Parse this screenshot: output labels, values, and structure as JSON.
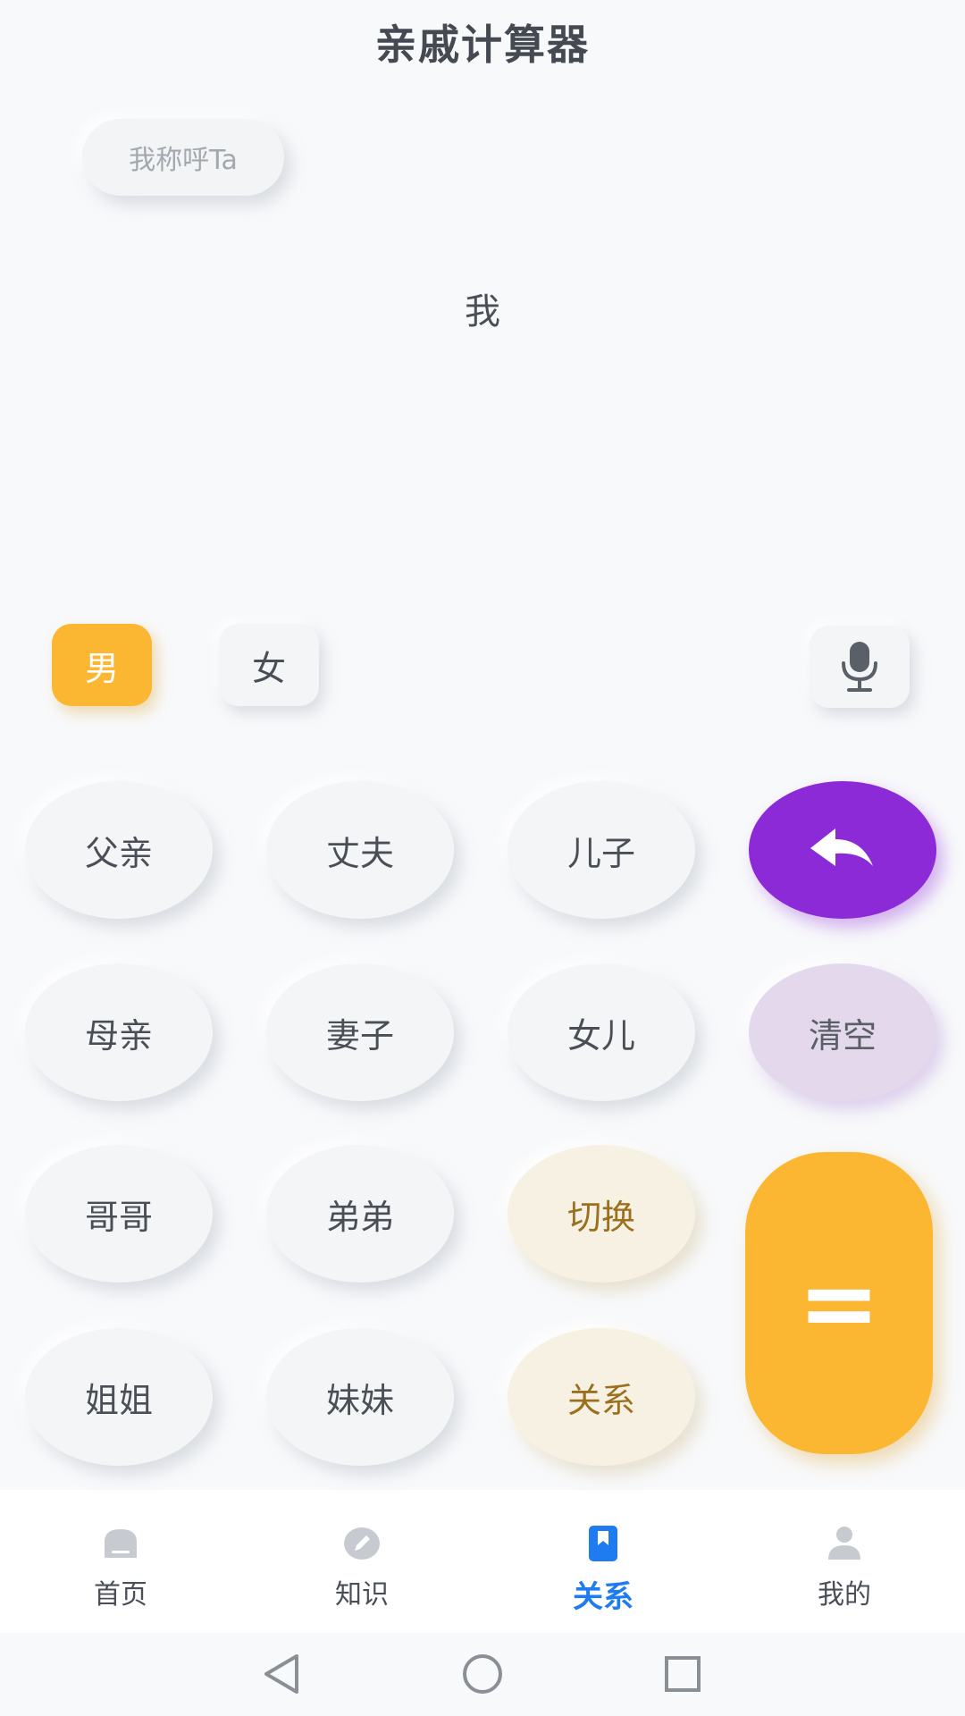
{
  "app": {
    "title": "亲戚计算器"
  },
  "mode": {
    "label": "我称呼Ta"
  },
  "display": {
    "text": "我"
  },
  "gender": {
    "male": "男",
    "female": "女"
  },
  "keys": [
    {
      "label": "父亲"
    },
    {
      "label": "丈夫"
    },
    {
      "label": "儿子"
    },
    {
      "label": "母亲"
    },
    {
      "label": "妻子"
    },
    {
      "label": "女儿"
    },
    {
      "label": "哥哥"
    },
    {
      "label": "弟弟"
    },
    {
      "label": "切换"
    },
    {
      "label": "姐姐"
    },
    {
      "label": "妹妹"
    },
    {
      "label": "关系"
    }
  ],
  "actions": {
    "clear": "清空",
    "equals": "="
  },
  "tabbar": {
    "items": [
      {
        "label": "首页"
      },
      {
        "label": "知识"
      },
      {
        "label": "关系"
      },
      {
        "label": "我的"
      }
    ]
  },
  "colors": {
    "accent_yellow": "#fbb632",
    "accent_purple": "#8c2ad8",
    "clear_lavender": "#e3d8ec",
    "cream": "#f6f1e2",
    "tab_active": "#1e7cf0"
  }
}
